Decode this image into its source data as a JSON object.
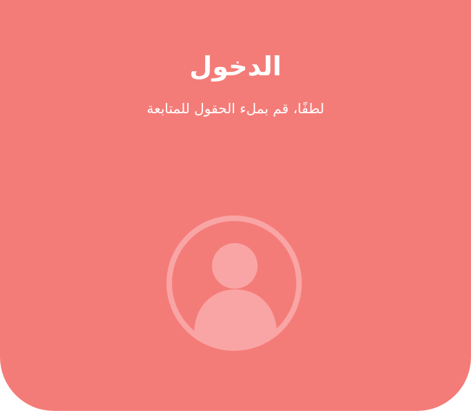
{
  "login": {
    "title": "الدخول",
    "subtitle": "لطفًا، قم بملء الحقول للمتابعة",
    "avatar_icon": "user-avatar-icon"
  },
  "colors": {
    "panel": "#f47c78",
    "avatar": "#f9a5a5",
    "text": "#ffffff",
    "background": "#ffffff"
  }
}
